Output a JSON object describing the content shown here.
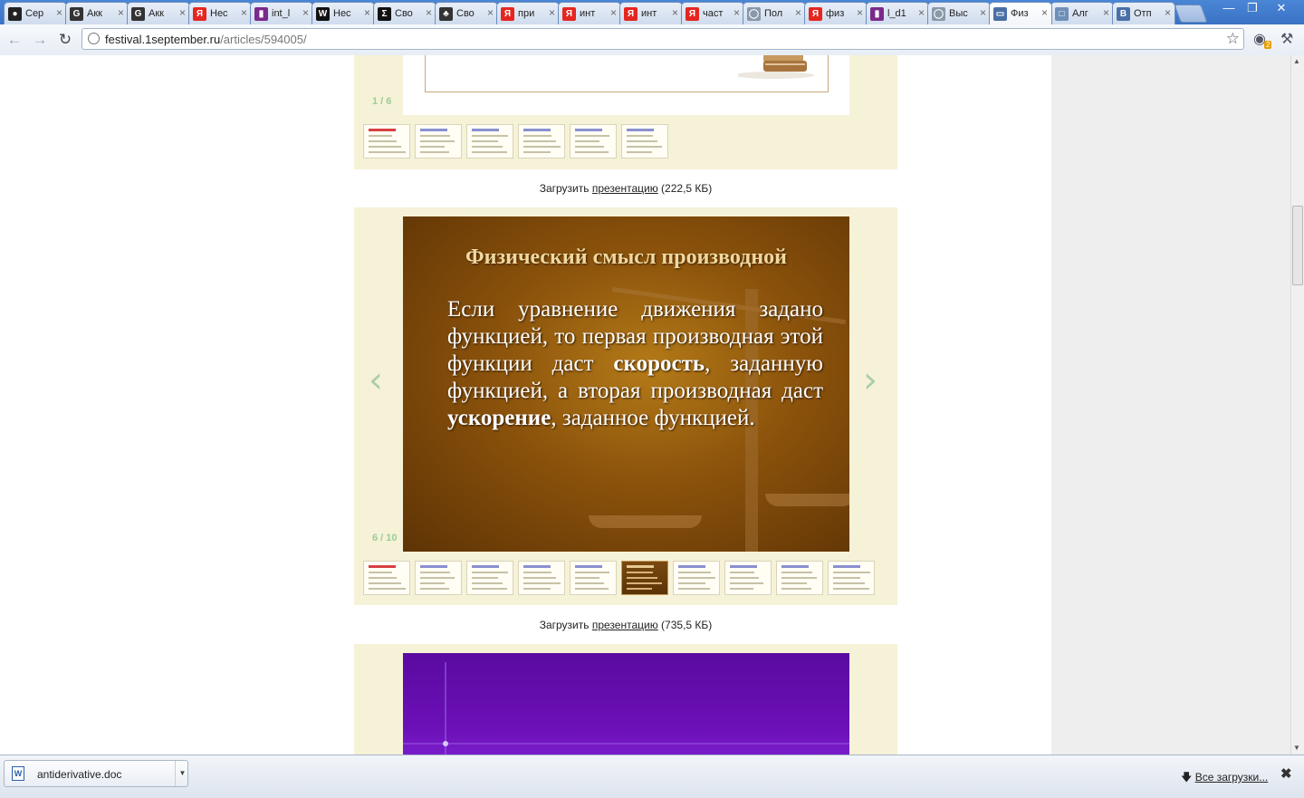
{
  "browser": {
    "tabs": [
      {
        "label": "Сер",
        "icon": "cat-icon",
        "color": "#222222"
      },
      {
        "label": "Акк",
        "icon": "google-icon",
        "color": "#333333"
      },
      {
        "label": "Акк",
        "icon": "google-icon",
        "color": "#333333"
      },
      {
        "label": "Нес",
        "icon": "yandex-icon",
        "color": "#e52620"
      },
      {
        "label": "int_l",
        "icon": "library-icon",
        "color": "#7a2a8a"
      },
      {
        "label": "Нес",
        "icon": "wikipedia-icon",
        "color": "#111111"
      },
      {
        "label": "Сво",
        "icon": "sigma-icon",
        "color": "#111111"
      },
      {
        "label": "Сво",
        "icon": "clover-icon",
        "color": "#333333"
      },
      {
        "label": "при",
        "icon": "yandex-icon",
        "color": "#e52620"
      },
      {
        "label": "инт",
        "icon": "yandex-icon",
        "color": "#e52620"
      },
      {
        "label": "инт",
        "icon": "yandex-icon",
        "color": "#e52620"
      },
      {
        "label": "част",
        "icon": "yandex-icon",
        "color": "#e52620"
      },
      {
        "label": "Пол",
        "icon": "globe-icon",
        "color": "#8899aa"
      },
      {
        "label": "физ",
        "icon": "yandex-icon",
        "color": "#e52620"
      },
      {
        "label": "l_d1",
        "icon": "library-icon",
        "color": "#7a2a8a"
      },
      {
        "label": "Выс",
        "icon": "globe-icon",
        "color": "#8899aa"
      },
      {
        "label": "Физ",
        "icon": "presentation-icon",
        "color": "#4a6fa5",
        "active": true
      },
      {
        "label": "Алг",
        "icon": "folder-icon",
        "color": "#6f8fb8"
      },
      {
        "label": "Отп",
        "icon": "vk-icon",
        "color": "#4a6fa5"
      }
    ],
    "url_host": "festival.1september.ru",
    "url_path": "/articles/594005/",
    "ext_badge": "2"
  },
  "page": {
    "panel1": {
      "counter": "1 / 6",
      "download_prefix": "Загрузить ",
      "download_link": "презентацию",
      "download_size": " (222,5 КБ)"
    },
    "panel2": {
      "slide_title": "Физический смысл производной",
      "slide_text_1": "Если уравнение движения задано функцией, то первая производная этой функции даст ",
      "slide_bold_1": "скорость",
      "slide_text_2": ", заданную функцией, а вторая производная даст ",
      "slide_bold_2": "ускорение",
      "slide_text_3": ", заданное функцией.",
      "counter": "6 / 10",
      "download_prefix": "Загрузить ",
      "download_link": "презентацию",
      "download_size": " (735,5 КБ)"
    }
  },
  "download_shelf": {
    "file_name": "antiderivative.doc",
    "doc_letter": "W",
    "all_downloads": "Все загрузки..."
  }
}
